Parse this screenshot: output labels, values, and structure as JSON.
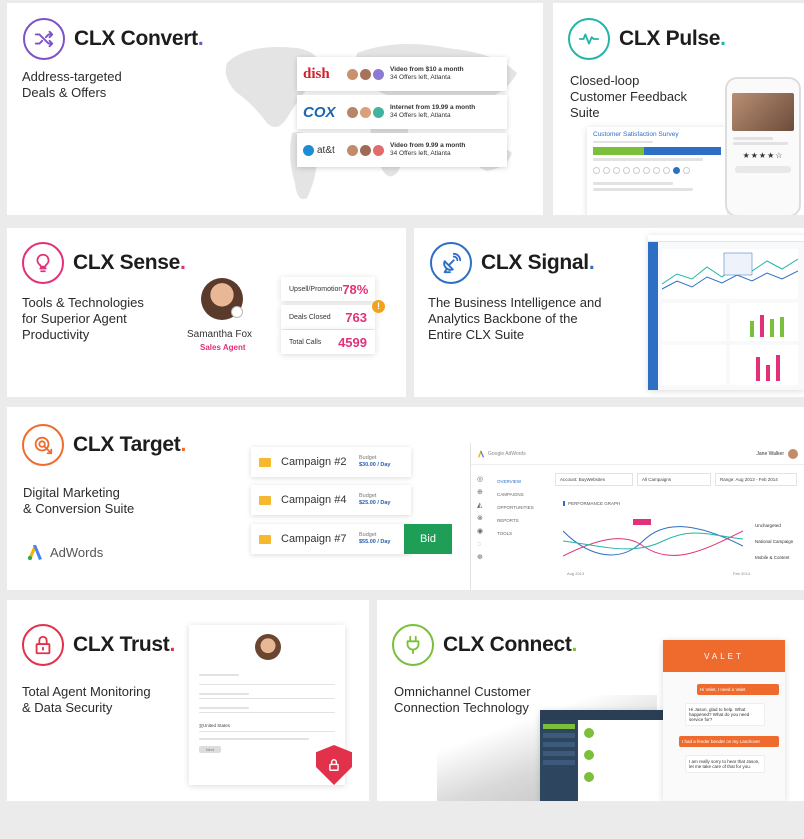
{
  "products": {
    "convert": {
      "name": "CLX Convert",
      "dot": ".",
      "tagline": "Address-targeted\nDeals & Offers",
      "deals": [
        {
          "brand": "dish",
          "title": "Video from $10 a month",
          "sub": "34 Offers left, Atlanta"
        },
        {
          "brand": "COX",
          "title": "Internet from 19.99 a month",
          "sub": "34 Offers left, Atlanta"
        },
        {
          "brand": "at&t",
          "title": "Video from 9.99 a month",
          "sub": "34 Offers left, Atlanta"
        }
      ]
    },
    "pulse": {
      "name": "CLX Pulse",
      "dot": ".",
      "tagline": "Closed-loop\nCustomer Feedback\nSuite",
      "survey_title": "Customer Satisfaction Survey"
    },
    "sense": {
      "name": "CLX Sense",
      "dot": ".",
      "tagline": "Tools & Technologies\nfor Superior Agent\nProductivity",
      "agent_name": "Samantha Fox",
      "agent_role": "Sales Agent",
      "stats": [
        {
          "label": "Upsell/Promotion",
          "value": "78%"
        },
        {
          "label": "Deals Closed",
          "value": "763"
        },
        {
          "label": "Total Calls",
          "value": "4599"
        }
      ],
      "alert": "!"
    },
    "signal": {
      "name": "CLX Signal",
      "dot": ".",
      "tagline": "The Business Intelligence and\nAnalytics Backbone of the\nEntire CLX Suite"
    },
    "target": {
      "name": "CLX Target",
      "dot": ".",
      "tagline": "Digital Marketing\n& Conversion Suite",
      "adwords": "AdWords",
      "campaigns": [
        {
          "name": "Campaign #2",
          "budget_label": "Budget",
          "budget": "$30.00 / Day"
        },
        {
          "name": "Campaign #4",
          "budget_label": "Budget",
          "budget": "$25.00 / Day"
        },
        {
          "name": "Campaign #7",
          "budget_label": "Budget",
          "budget": "$55.00 / Day"
        }
      ],
      "bid_label": "Bid",
      "dashboard": {
        "app": "Google AdWords",
        "user": "Jane Walker",
        "nav": [
          "OVERVIEW",
          "CAMPAIGNS",
          "OPPORTUNITIES",
          "REPORTS",
          "TOOLS"
        ],
        "filters": [
          "Account: BuyWebsites",
          "All Campaigns",
          "Range: Aug 2013 - Feb 2014"
        ],
        "graph_title": "PERFORMANCE GRAPH",
        "legend": [
          "Unchargeted",
          "National Campaign",
          "Mobile & Content"
        ],
        "x_start": "Aug 2013",
        "x_end": "Feb 2014"
      }
    },
    "trust": {
      "name": "CLX Trust",
      "dot": ".",
      "tagline": "Total Agent Monitoring\n& Data Security",
      "form_country": "United States",
      "form_button": "Next"
    },
    "connect": {
      "name": "CLX Connect",
      "dot": ".",
      "tagline": "Omnichannel Customer\nConnection Technology",
      "chat_header": "VALET",
      "messages": [
        {
          "from": "user",
          "text": "Hi Valet, I need a Valet"
        },
        {
          "from": "agent",
          "text": "Hi Jason, glad to help. What happened? What do you need service for?"
        },
        {
          "from": "user",
          "text": "I had a fender bender on my Landrover"
        },
        {
          "from": "agent",
          "text": "I am really sorry to hear that Jason, let me take care of that for you."
        }
      ]
    }
  },
  "colors": {
    "convert": "#7d52c7",
    "pulse": "#23b5a5",
    "sense": "#e2317a",
    "signal": "#2d6fc4",
    "target": "#ef6b2d",
    "trust": "#e2314a",
    "connect": "#7bbf3b"
  }
}
